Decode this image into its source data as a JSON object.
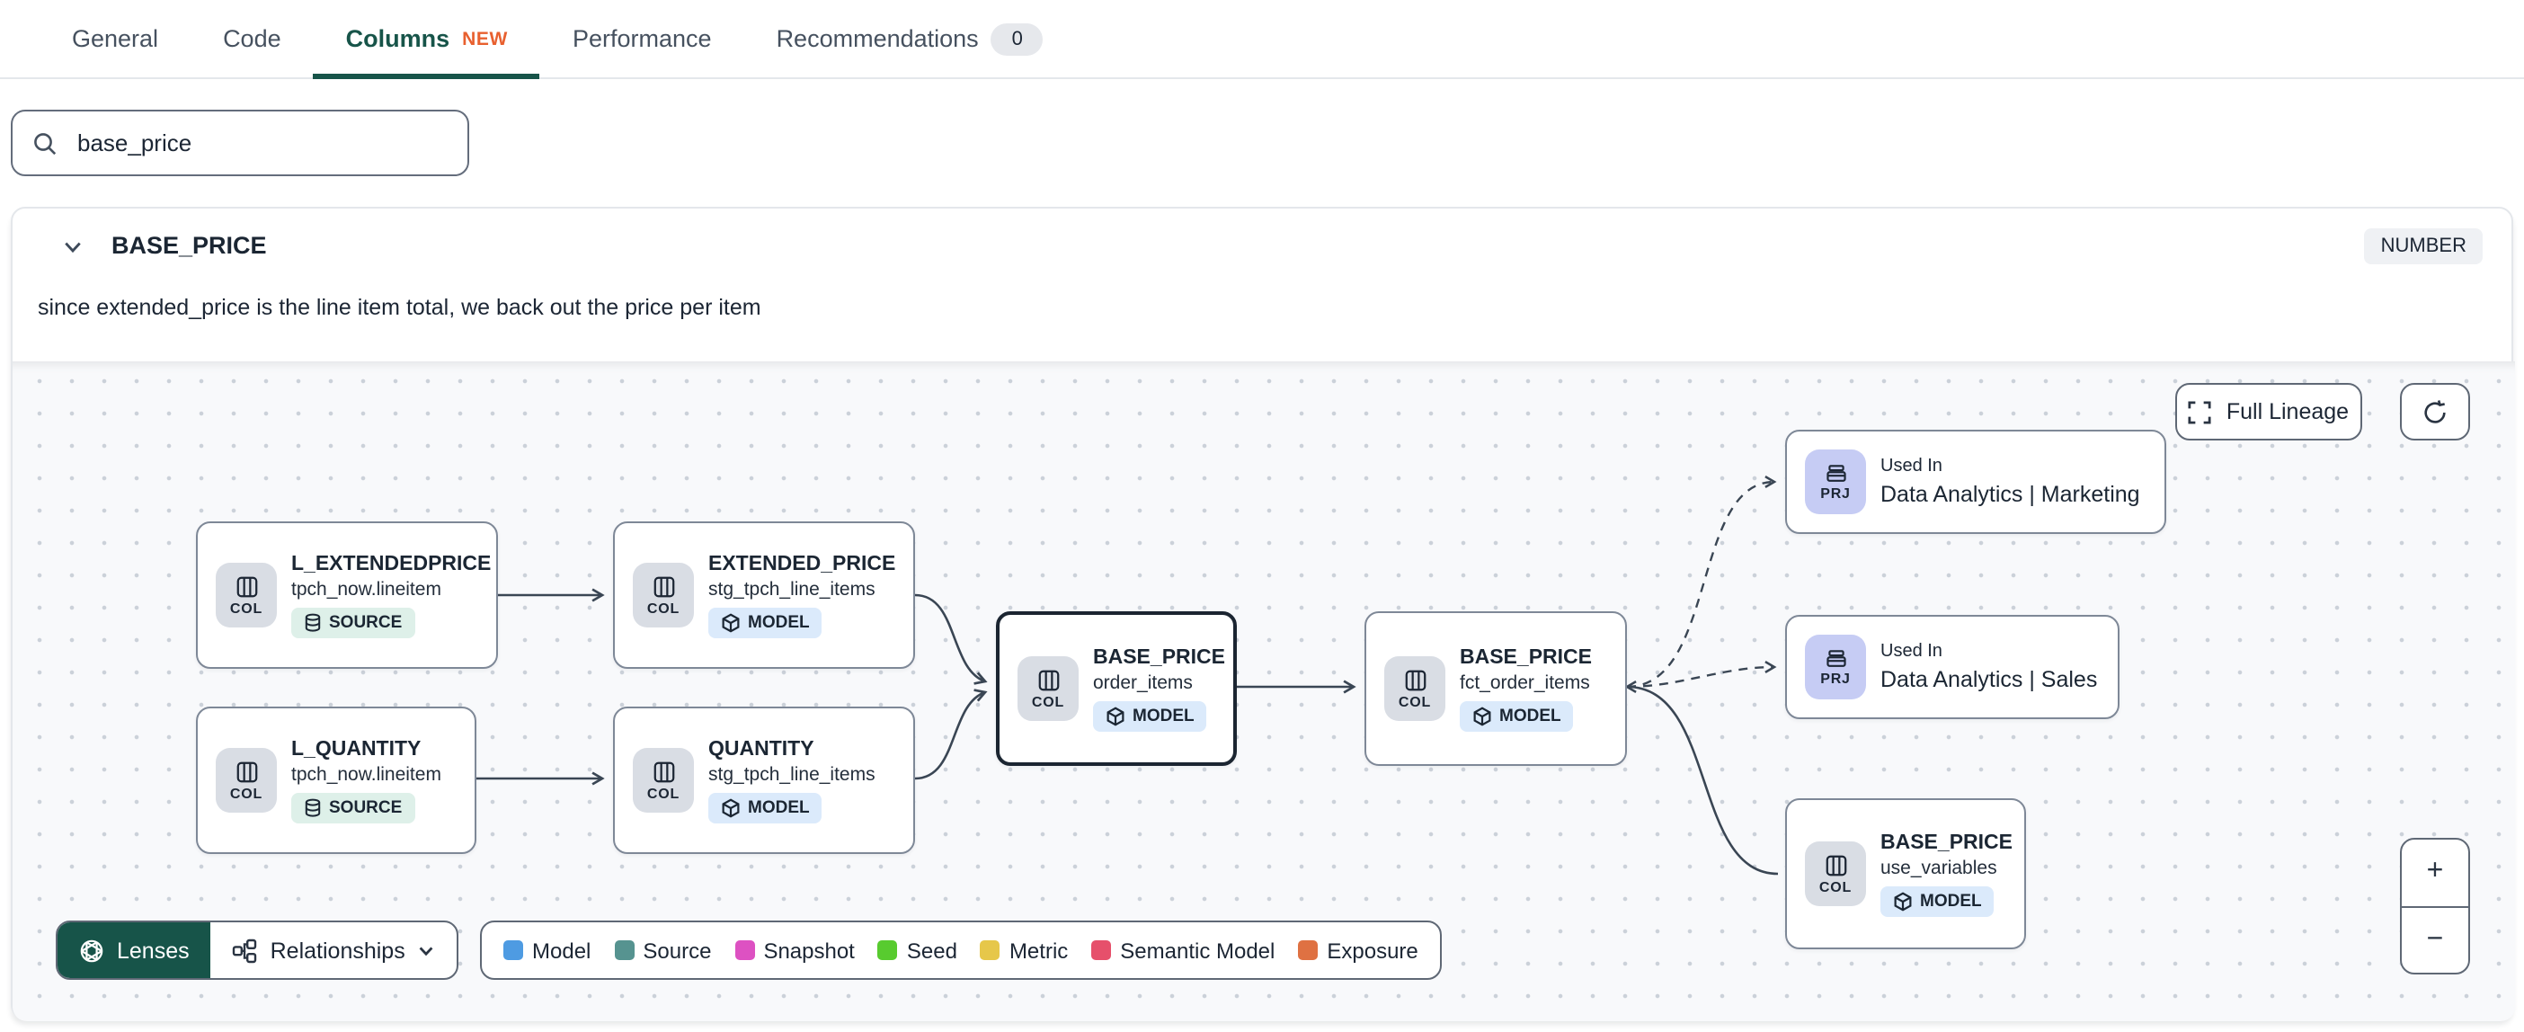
{
  "tabs": {
    "items": [
      {
        "label": "General"
      },
      {
        "label": "Code"
      },
      {
        "label": "Columns",
        "badge": "NEW"
      },
      {
        "label": "Performance"
      },
      {
        "label": "Recommendations",
        "count": "0"
      }
    ]
  },
  "search": {
    "value": "base_price",
    "icon": "search-icon"
  },
  "column_detail": {
    "name": "BASE_PRICE",
    "data_type": "NUMBER",
    "description": "since extended_price is the line item total, we back out the price per item"
  },
  "lineage": {
    "controls": {
      "full_lineage_label": "Full Lineage",
      "refresh_icon": "refresh-icon",
      "zoom_in": "+",
      "zoom_out": "−"
    },
    "nodes": [
      {
        "chip": "COL",
        "title": "L_EXTENDEDPRICE",
        "subtitle": "tpch_now.lineitem",
        "badge": "SOURCE"
      },
      {
        "chip": "COL",
        "title": "L_QUANTITY",
        "subtitle": "tpch_now.lineitem",
        "badge": "SOURCE"
      },
      {
        "chip": "COL",
        "title": "EXTENDED_PRICE",
        "subtitle": "stg_tpch_line_items",
        "badge": "MODEL"
      },
      {
        "chip": "COL",
        "title": "QUANTITY",
        "subtitle": "stg_tpch_line_items",
        "badge": "MODEL"
      },
      {
        "chip": "COL",
        "title": "BASE_PRICE",
        "subtitle": "order_items",
        "badge": "MODEL",
        "selected": true
      },
      {
        "chip": "COL",
        "title": "BASE_PRICE",
        "subtitle": "fct_order_items",
        "badge": "MODEL"
      },
      {
        "chip": "COL",
        "title": "BASE_PRICE",
        "subtitle": "use_variables",
        "badge": "MODEL"
      }
    ],
    "projects": [
      {
        "chip": "PRJ",
        "label": "Used In",
        "name": "Data Analytics | Marketing"
      },
      {
        "chip": "PRJ",
        "label": "Used In",
        "name": "Data Analytics | Sales"
      }
    ],
    "toolbar": {
      "lenses_label": "Lenses",
      "relationships_label": "Relationships"
    },
    "legend": {
      "items": [
        {
          "label": "Model",
          "color": "#4E9BE2"
        },
        {
          "label": "Source",
          "color": "#569390"
        },
        {
          "label": "Snapshot",
          "color": "#DD51C2"
        },
        {
          "label": "Seed",
          "color": "#58CB2F"
        },
        {
          "label": "Metric",
          "color": "#E6C74A"
        },
        {
          "label": "Semantic Model",
          "color": "#E6506B"
        },
        {
          "label": "Exposure",
          "color": "#DF7142"
        }
      ]
    }
  }
}
